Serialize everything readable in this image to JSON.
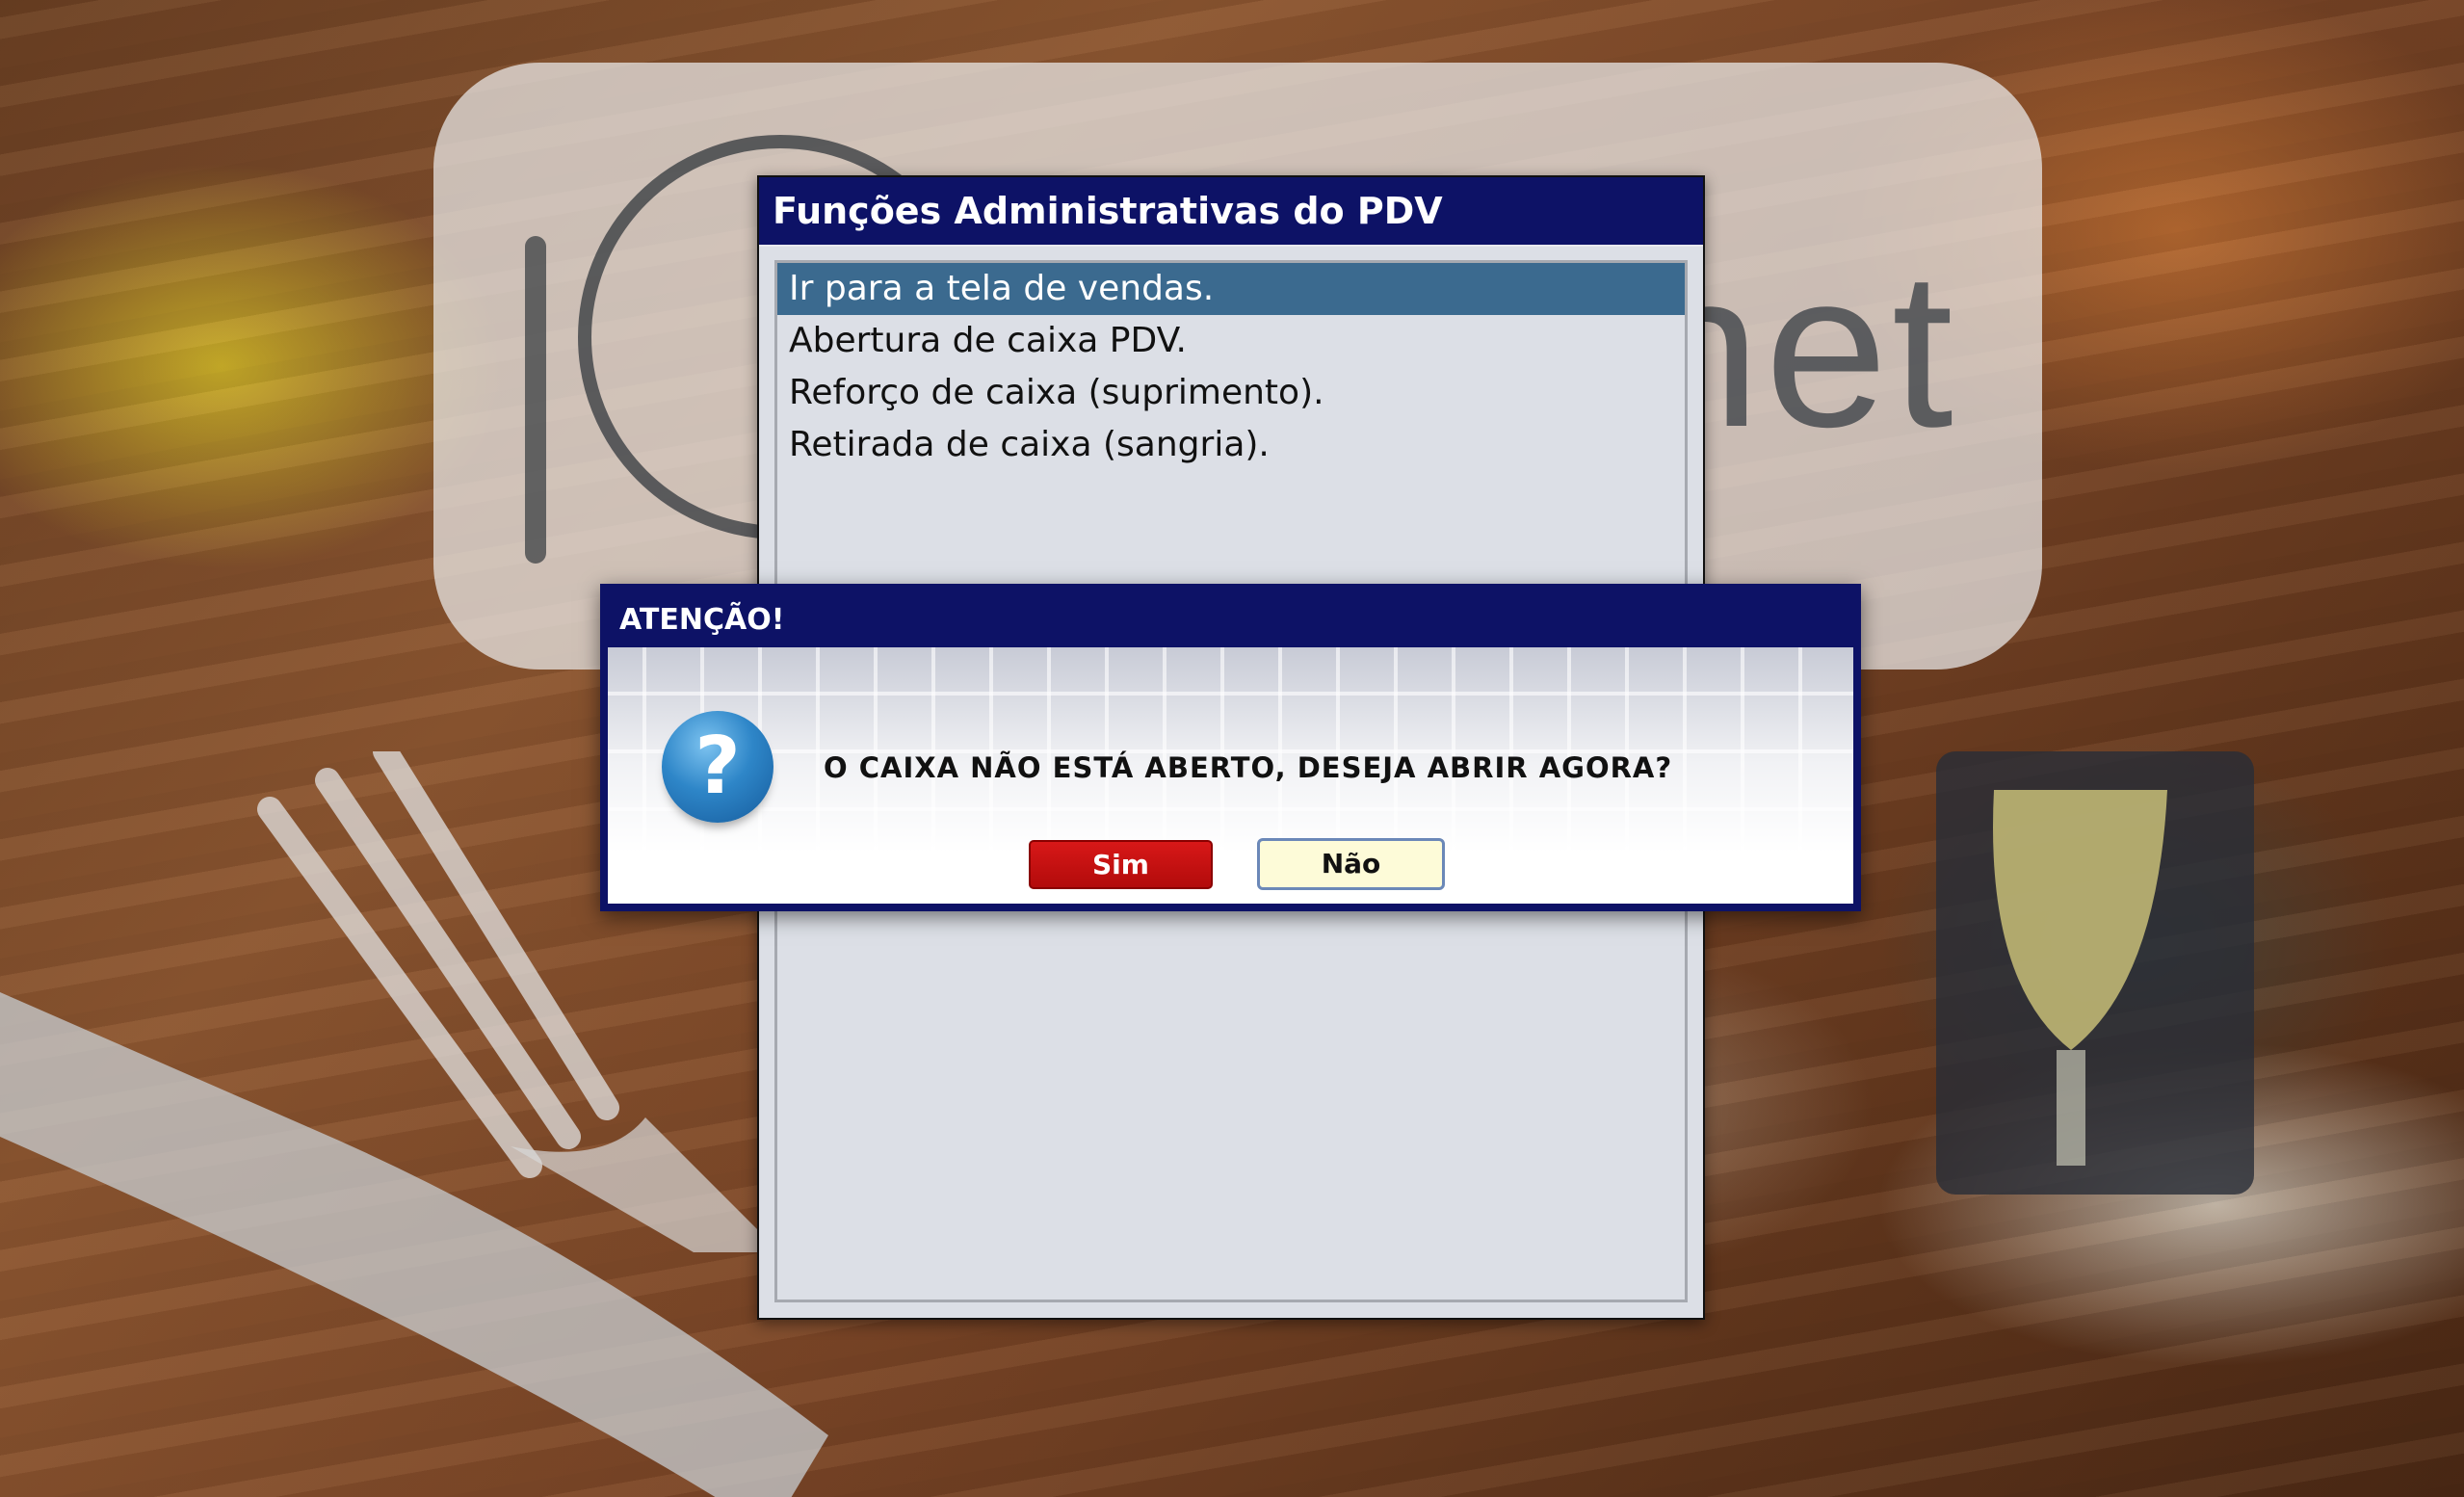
{
  "background": {
    "logo_text": "net"
  },
  "admin_window": {
    "title": "Funções Administrativas do PDV",
    "items": [
      {
        "label": "Ir para a tela de vendas.",
        "selected": true
      },
      {
        "label": "Abertura de caixa PDV.",
        "selected": false
      },
      {
        "label": "Reforço de caixa (suprimento).",
        "selected": false
      },
      {
        "label": "Retirada de caixa (sangria).",
        "selected": false
      }
    ]
  },
  "dialog": {
    "title": "ATENÇÃO!",
    "icon": "question-icon",
    "message": "O CAIXA NÃO ESTÁ ABERTO, DESEJA ABRIR AGORA?",
    "yes_label": "Sim",
    "no_label": "Não"
  },
  "colors": {
    "titlebar": "#0d1266",
    "selected_row": "#3b6a8f",
    "yes_button": "#c81010",
    "no_button": "#fdfbd8"
  }
}
